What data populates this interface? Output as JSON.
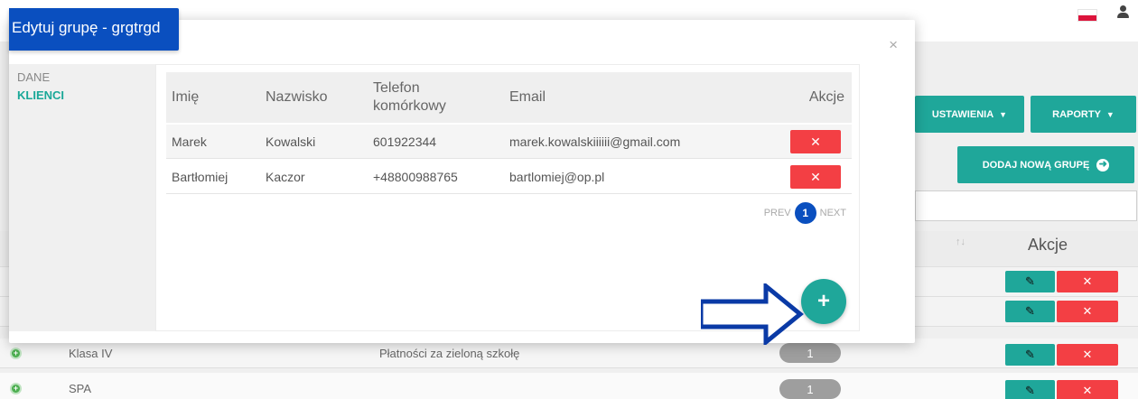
{
  "background": {
    "settings_button": "USTAWIENIA",
    "reports_button": "RAPORTY",
    "add_group_button": "DODAJ NOWĄ GRUPĘ",
    "actions_header": "Akcje",
    "rows": [
      {
        "name": "Klasa IV",
        "desc": "Płatności za zieloną szkołę",
        "count": "1"
      },
      {
        "name": "SPA",
        "desc": "",
        "count": "1"
      }
    ],
    "language": "pl"
  },
  "modal": {
    "title": "Edytuj grupę - grgtrgd",
    "close": "×",
    "sidebar": [
      {
        "label": "DANE",
        "active": false
      },
      {
        "label": "KLIENCI",
        "active": true
      }
    ],
    "table": {
      "headers": [
        "Imię",
        "Nazwisko",
        "Telefon komórkowy",
        "Email",
        "Akcje"
      ],
      "rows": [
        {
          "first": "Marek",
          "last": "Kowalski",
          "phone": "601922344",
          "email": "marek.kowalskiiiiii@gmail.com"
        },
        {
          "first": "Bartłomiej",
          "last": "Kaczor",
          "phone": "+48800988765",
          "email": "bartlomiej@op.pl"
        }
      ]
    },
    "pagination": {
      "prev": "PREV",
      "current": "1",
      "next": "NEXT"
    },
    "add_button": "+"
  },
  "colors": {
    "primary_blue": "#0a4fbf",
    "teal": "#1fa79a",
    "danger": "#f33f44",
    "annotation_arrow": "#0a3aa6"
  }
}
